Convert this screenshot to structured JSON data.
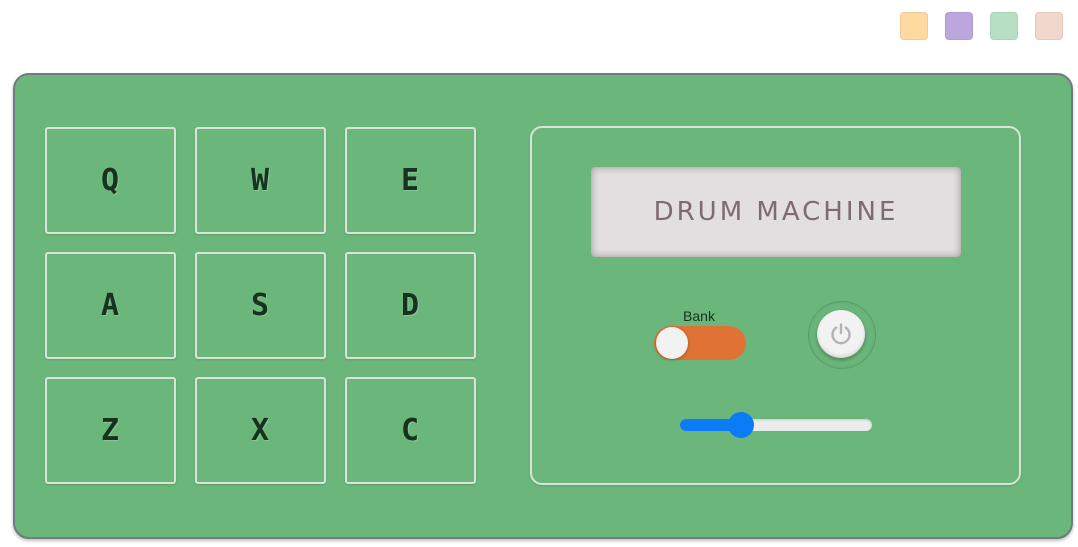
{
  "palette": {
    "swatches": [
      "#fed9a0",
      "#bba7de",
      "#b7dfc3",
      "#f1d7cc"
    ],
    "accent_orange": "#e07235",
    "panel_green": "#6bb77b",
    "pad_text": "#17331e",
    "screen_bg": "#e3dfe0",
    "screen_text": "#7e6b6f",
    "slider_blue": "#0b7cf6",
    "knob_white": "#f2f2f2"
  },
  "drum_pads": [
    {
      "key": "Q"
    },
    {
      "key": "W"
    },
    {
      "key": "E"
    },
    {
      "key": "A"
    },
    {
      "key": "S"
    },
    {
      "key": "D"
    },
    {
      "key": "Z"
    },
    {
      "key": "X"
    },
    {
      "key": "C"
    }
  ],
  "display": {
    "text": "DRUM MACHINE"
  },
  "bank_switch": {
    "label": "Bank",
    "on": false
  },
  "power_button": {
    "icon": "power-icon"
  },
  "volume": {
    "value": 0.32
  }
}
